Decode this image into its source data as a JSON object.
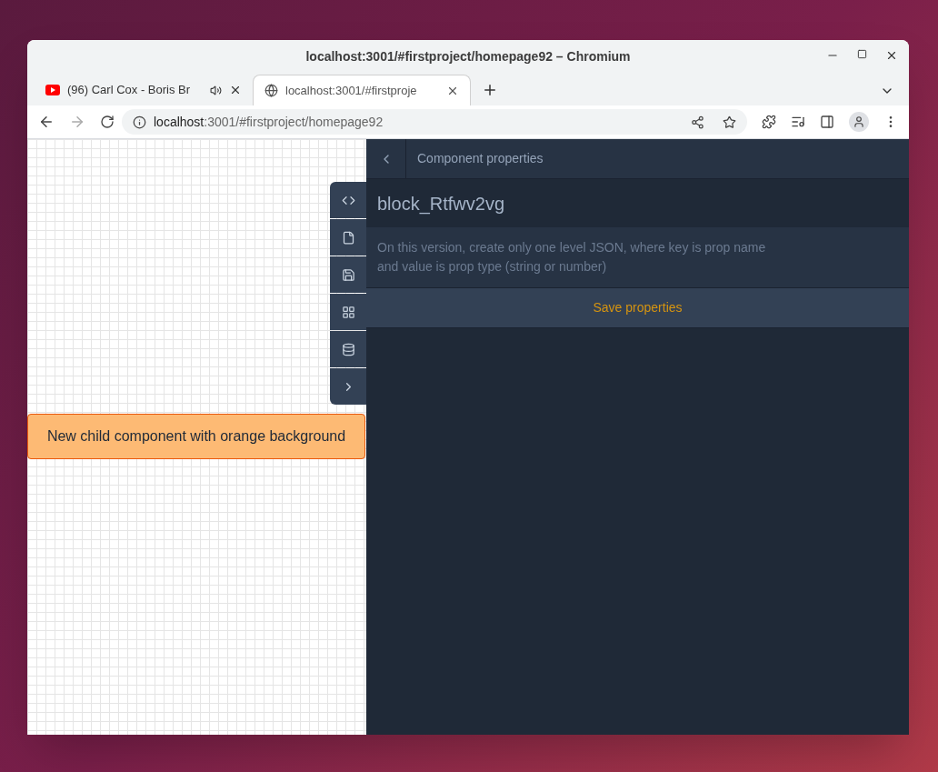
{
  "window": {
    "title": "localhost:3001/#firstproject/homepage92 – Chromium"
  },
  "tabs": [
    {
      "title": "(96) Carl Cox - Boris Br",
      "kind": "video",
      "audio": true,
      "selected": false
    },
    {
      "title": "localhost:3001/#firstproje",
      "kind": "page",
      "audio": false,
      "selected": true
    }
  ],
  "address_bar": {
    "host": "localhost",
    "path": ":3001/#firstproject/homepage92"
  },
  "canvas": {
    "block": {
      "text": "New child component with orange background"
    }
  },
  "toolbar": [
    {
      "kind": "code"
    },
    {
      "kind": "file"
    },
    {
      "kind": "save"
    },
    {
      "kind": "grid"
    },
    {
      "kind": "database"
    },
    {
      "kind": "expand"
    }
  ],
  "panel": {
    "header": "Component properties",
    "component_name": "block_Rtfwv2vg",
    "hint": "On this version, create only one level JSON, where key is prop name\nand value is prop type (string or number)",
    "save_button": "Save properties"
  }
}
